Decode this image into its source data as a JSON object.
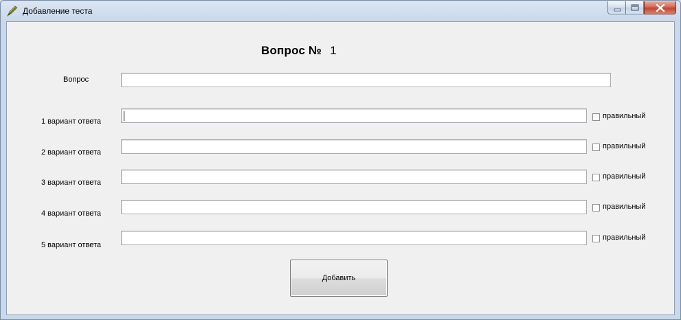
{
  "window": {
    "title": "Добавление теста",
    "controls": [
      "minimize",
      "maximize",
      "close"
    ]
  },
  "heading": {
    "label": "Вопрос №",
    "number": "1"
  },
  "question": {
    "label": "Вопрос",
    "value": ""
  },
  "answers": [
    {
      "label": "1 вариант ответа",
      "value": "",
      "checkbox_label": "правильный",
      "checked": false
    },
    {
      "label": "2 вариант ответа",
      "value": "",
      "checkbox_label": "правильный",
      "checked": false
    },
    {
      "label": "3 вариант ответа",
      "value": "",
      "checkbox_label": "правильный",
      "checked": false
    },
    {
      "label": "4 вариант ответа",
      "value": "",
      "checkbox_label": "правильный",
      "checked": false
    },
    {
      "label": "5 вариант ответа",
      "value": "",
      "checkbox_label": "правильный",
      "checked": false
    }
  ],
  "add_button": {
    "label": "Добавить"
  },
  "colors": {
    "frame": "#cfdbe8",
    "client": "#f0f0f0",
    "close_button": "#c2402a"
  },
  "icons": {
    "app": "app-quill-icon",
    "minimize": "minimize-icon",
    "maximize": "maximize-icon",
    "close": "close-icon"
  }
}
